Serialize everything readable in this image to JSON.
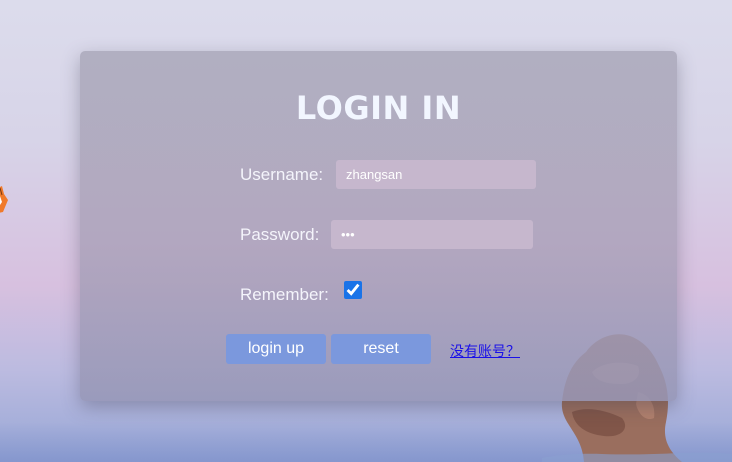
{
  "login_form": {
    "title": "LOGIN IN",
    "username_label": "Username:",
    "username_value": "zhangsan",
    "password_label": "Password:",
    "password_value": "abc",
    "remember_label": "Remember:",
    "remember_checked": true,
    "login_button_label": "login up",
    "reset_button_label": "reset",
    "register_link_text": "没有账号？"
  },
  "colors": {
    "button": "#7b98dd",
    "input_bg": "#c6b7cd",
    "title": "#f2f6ff",
    "link": "#1a10e8"
  }
}
